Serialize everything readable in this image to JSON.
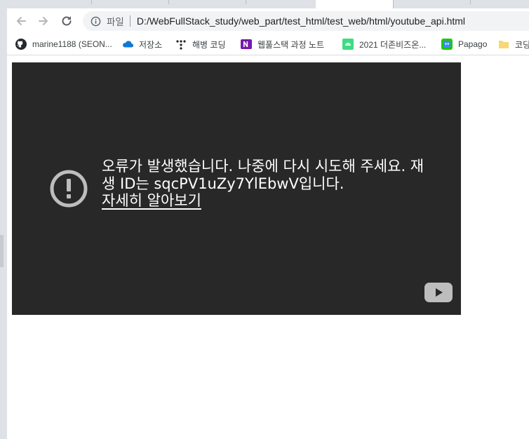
{
  "browser": {
    "omnibox": {
      "scheme_label": "파일",
      "url": "D:/WebFullStack_study/web_part/test_html/test_web/html/youtube_api.html"
    },
    "bookmarks": [
      {
        "label": "marine1188 (SEON...",
        "icon": "github-icon"
      },
      {
        "label": "저장소",
        "icon": "cloud-icon"
      },
      {
        "label": "해병 코딩",
        "icon": "dots-tree-icon"
      },
      {
        "label": "웹풀스택 과정 노트",
        "icon": "onenote-icon"
      },
      {
        "label": "2021 더존비즈온...",
        "icon": "android-icon"
      },
      {
        "label": "Papago",
        "icon": "papago-icon"
      },
      {
        "label": "코딩",
        "icon": "folder-icon"
      }
    ]
  },
  "player": {
    "error_message": "오류가 발생했습니다. 나중에 다시 시도해 주세요. 재생 ID는 sqcPV1uZy7YlEbwV입니다.",
    "learn_more": "자세히 알아보기"
  },
  "colors": {
    "player_bg": "#282828",
    "error_icon": "#bdbdbd",
    "omnibox_bg": "#f1f3f4"
  }
}
